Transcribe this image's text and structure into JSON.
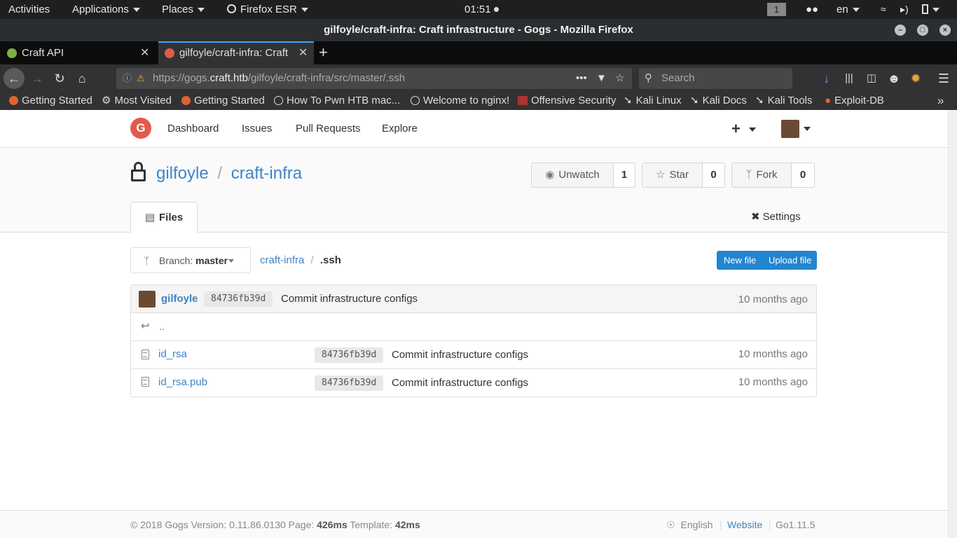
{
  "system_bar": {
    "activities": "Activities",
    "applications": "Applications",
    "places": "Places",
    "firefox": "Firefox ESR",
    "clock": "01:51",
    "workspace": "1",
    "lang": "en"
  },
  "window": {
    "title": "gilfoyle/craft-infra: Craft infrastructure - Gogs - Mozilla Firefox"
  },
  "tabs": [
    {
      "label": "Craft API"
    },
    {
      "label": "gilfoyle/craft-infra: Craft"
    }
  ],
  "navbar": {
    "url_prefix": "https://gogs.",
    "url_host": "craft.htb",
    "url_path": "/gilfoyle/craft-infra/src/master/.ssh",
    "search_placeholder": "Search"
  },
  "bookmarks": [
    {
      "label": "Getting Started",
      "icon": "firefox-icon"
    },
    {
      "label": "Most Visited",
      "icon": "gear-icon"
    },
    {
      "label": "Getting Started",
      "icon": "firefox-icon"
    },
    {
      "label": "How To Pwn HTB mac...",
      "icon": "globe-icon"
    },
    {
      "label": "Welcome to nginx!",
      "icon": "globe-icon"
    },
    {
      "label": "Offensive Security",
      "icon": "offsec-icon"
    },
    {
      "label": "Kali Linux",
      "icon": "kali-icon"
    },
    {
      "label": "Kali Docs",
      "icon": "kali-icon"
    },
    {
      "label": "Kali Tools",
      "icon": "kali-icon"
    },
    {
      "label": "Exploit-DB",
      "icon": "exploitdb-icon"
    }
  ],
  "gogs_nav": {
    "dashboard": "Dashboard",
    "issues": "Issues",
    "pulls": "Pull Requests",
    "explore": "Explore"
  },
  "repo": {
    "owner": "gilfoyle",
    "separator": "/",
    "name": "craft-infra",
    "unwatch": "Unwatch",
    "watch_count": "1",
    "star": "Star",
    "star_count": "0",
    "fork": "Fork",
    "fork_count": "0",
    "files_tab": "Files",
    "settings": "Settings"
  },
  "branch": {
    "label": "Branch:",
    "name": "master"
  },
  "path": {
    "root": "craft-infra",
    "sep": "/",
    "current": ".ssh"
  },
  "actions": {
    "new_file": "New file",
    "upload_file": "Upload file"
  },
  "latest_commit": {
    "author": "gilfoyle",
    "sha": "84736fb39d",
    "message": "Commit infrastructure configs",
    "age": "10 months ago"
  },
  "parent_dir": "..",
  "files": [
    {
      "name": "id_rsa",
      "sha": "84736fb39d",
      "message": "Commit infrastructure configs",
      "age": "10 months ago"
    },
    {
      "name": "id_rsa.pub",
      "sha": "84736fb39d",
      "message": "Commit infrastructure configs",
      "age": "10 months ago"
    }
  ],
  "footer": {
    "copyright": "© 2018 Gogs Version: 0.11.86.0130 Page:",
    "page_time": "426ms",
    "template_label": "Template:",
    "template_time": "42ms",
    "language": "English",
    "website": "Website",
    "go_version": "Go1.11.5"
  }
}
